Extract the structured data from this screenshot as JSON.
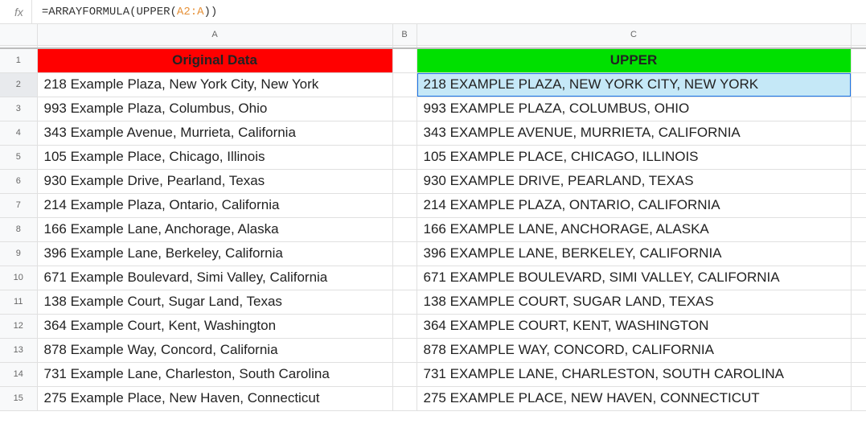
{
  "formula": {
    "prefix": "=ARRAYFORMULA(UPPER(",
    "range": "A2:A",
    "suffix": "))"
  },
  "columns": [
    "A",
    "B",
    "C"
  ],
  "headers": {
    "a": "Original Data",
    "c": "UPPER"
  },
  "rows": [
    {
      "num": "1"
    },
    {
      "num": "2",
      "a": "218 Example Plaza, New York City, New York",
      "c": "218 EXAMPLE PLAZA, NEW YORK CITY, NEW YORK"
    },
    {
      "num": "3",
      "a": "993 Example Plaza, Columbus, Ohio",
      "c": "993 EXAMPLE PLAZA, COLUMBUS, OHIO"
    },
    {
      "num": "4",
      "a": "343 Example Avenue, Murrieta, California",
      "c": "343 EXAMPLE AVENUE, MURRIETA, CALIFORNIA"
    },
    {
      "num": "5",
      "a": "105 Example Place, Chicago, Illinois",
      "c": "105 EXAMPLE PLACE, CHICAGO, ILLINOIS"
    },
    {
      "num": "6",
      "a": "930 Example Drive, Pearland, Texas",
      "c": "930 EXAMPLE DRIVE, PEARLAND, TEXAS"
    },
    {
      "num": "7",
      "a": "214 Example Plaza, Ontario, California",
      "c": "214 EXAMPLE PLAZA, ONTARIO, CALIFORNIA"
    },
    {
      "num": "8",
      "a": "166 Example Lane, Anchorage, Alaska",
      "c": "166 EXAMPLE LANE, ANCHORAGE, ALASKA"
    },
    {
      "num": "9",
      "a": "396 Example Lane, Berkeley, California",
      "c": "396 EXAMPLE LANE, BERKELEY, CALIFORNIA"
    },
    {
      "num": "10",
      "a": "671 Example Boulevard, Simi Valley, California",
      "c": "671 EXAMPLE BOULEVARD, SIMI VALLEY, CALIFORNIA"
    },
    {
      "num": "11",
      "a": "138 Example Court, Sugar Land, Texas",
      "c": "138 EXAMPLE COURT, SUGAR LAND, TEXAS"
    },
    {
      "num": "12",
      "a": "364 Example Court, Kent, Washington",
      "c": "364 EXAMPLE COURT, KENT, WASHINGTON"
    },
    {
      "num": "13",
      "a": "878 Example Way, Concord, California",
      "c": "878 EXAMPLE WAY, CONCORD, CALIFORNIA"
    },
    {
      "num": "14",
      "a": "731 Example Lane, Charleston, South Carolina",
      "c": "731 EXAMPLE LANE, CHARLESTON, SOUTH CAROLINA"
    },
    {
      "num": "15",
      "a": "275 Example Place, New Haven, Connecticut",
      "c": "275 EXAMPLE PLACE, NEW HAVEN, CONNECTICUT"
    }
  ],
  "selected_cell": "C2"
}
